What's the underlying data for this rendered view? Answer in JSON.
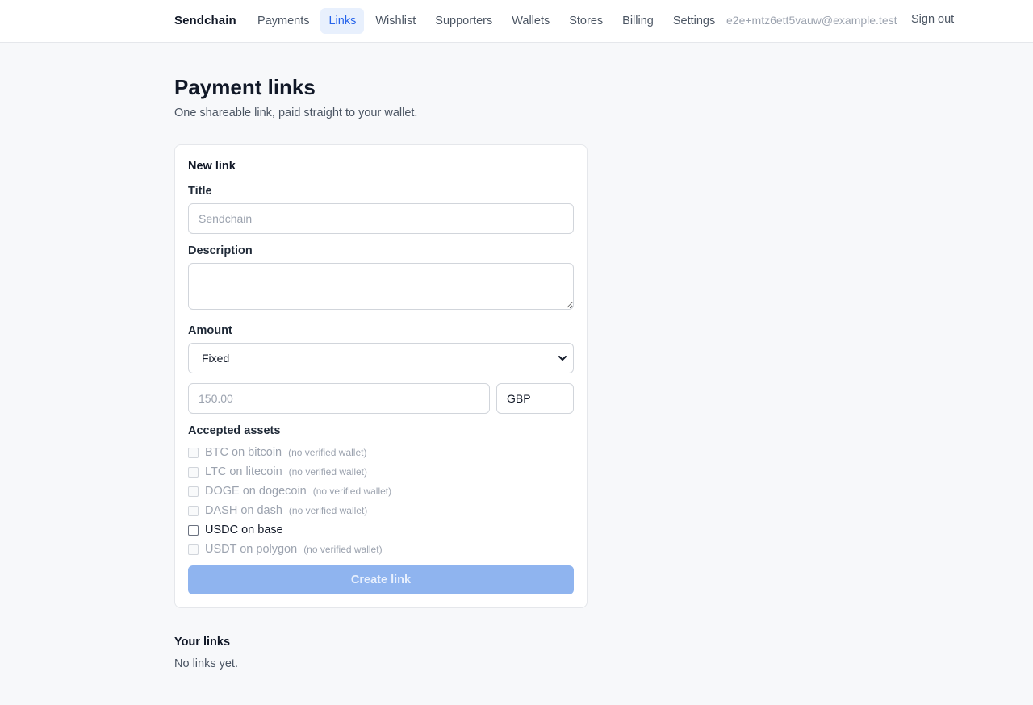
{
  "app": {
    "brand": "Sendchain"
  },
  "nav": {
    "items": [
      {
        "label": "Payments",
        "active": false
      },
      {
        "label": "Links",
        "active": true
      },
      {
        "label": "Wishlist",
        "active": false
      },
      {
        "label": "Supporters",
        "active": false
      },
      {
        "label": "Wallets",
        "active": false
      },
      {
        "label": "Stores",
        "active": false
      },
      {
        "label": "Billing",
        "active": false
      },
      {
        "label": "Settings",
        "active": false
      }
    ],
    "user_email": "e2e+mtz6ett5vauw@example.test",
    "sign_out_label": "Sign out"
  },
  "page": {
    "title": "Payment links",
    "subtitle": "One shareable link, paid straight to your wallet."
  },
  "form": {
    "card_title": "New link",
    "title_label": "Title",
    "title_placeholder": "Sendchain",
    "title_value": "",
    "description_label": "Description",
    "description_value": "",
    "amount_label": "Amount",
    "amount_mode": "Fixed",
    "amount_placeholder": "150.00",
    "amount_value": "",
    "currency_value": "GBP",
    "assets_label": "Accepted assets",
    "assets": [
      {
        "label": "BTC on bitcoin",
        "note": "(no verified wallet)",
        "enabled": false,
        "checked": false
      },
      {
        "label": "LTC on litecoin",
        "note": "(no verified wallet)",
        "enabled": false,
        "checked": false
      },
      {
        "label": "DOGE on dogecoin",
        "note": "(no verified wallet)",
        "enabled": false,
        "checked": false
      },
      {
        "label": "DASH on dash",
        "note": "(no verified wallet)",
        "enabled": false,
        "checked": false
      },
      {
        "label": "USDC on base",
        "note": "",
        "enabled": true,
        "checked": false
      },
      {
        "label": "USDT on polygon",
        "note": "(no verified wallet)",
        "enabled": false,
        "checked": false
      }
    ],
    "submit_label": "Create link",
    "submit_disabled": true
  },
  "links": {
    "section_title": "Your links",
    "empty_text": "No links yet."
  },
  "colors": {
    "accent": "#2563eb",
    "accent_soft": "#e8f0fd",
    "button_disabled": "#8fb4ef",
    "background": "#f7f8fa"
  }
}
